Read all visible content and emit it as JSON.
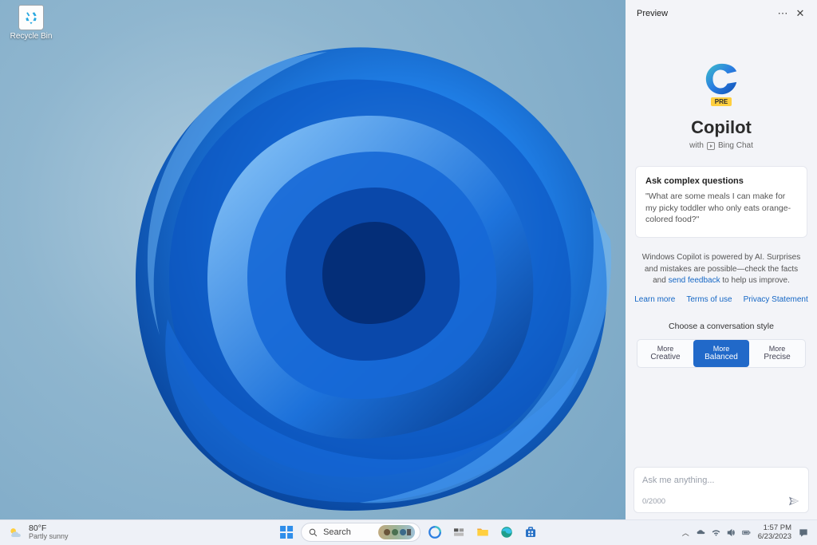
{
  "desktop": {
    "recycle_bin_label": "Recycle Bin"
  },
  "copilot": {
    "header_title": "Preview",
    "logo_badge": "PRE",
    "product_name": "Copilot",
    "subline_prefix": "with",
    "subline_brand": "Bing Chat",
    "card": {
      "title": "Ask complex questions",
      "body": "\"What are some meals I can make for my picky toddler who only eats orange-colored food?\""
    },
    "disclaimer_pre": "Windows Copilot is powered by AI. Surprises and mistakes are possible—check the facts and ",
    "disclaimer_link": "send feedback",
    "disclaimer_post": " to help us improve.",
    "links": {
      "learn": "Learn more",
      "terms": "Terms of use",
      "privacy": "Privacy Statement"
    },
    "style_label": "Choose a conversation style",
    "styles": [
      {
        "l1": "More",
        "l2": "Creative"
      },
      {
        "l1": "More",
        "l2": "Balanced"
      },
      {
        "l1": "More",
        "l2": "Precise"
      }
    ],
    "input_placeholder": "Ask me anything...",
    "char_counter": "0/2000"
  },
  "taskbar": {
    "weather": {
      "temp": "80°F",
      "cond": "Partly sunny"
    },
    "search_label": "Search",
    "clock": {
      "time": "1:57 PM",
      "date": "6/23/2023"
    }
  }
}
